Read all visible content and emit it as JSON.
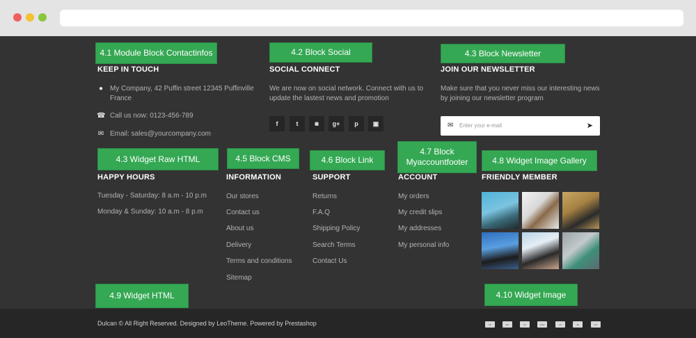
{
  "tags": {
    "contactinfos": "4.1 Module Block Contactinfos",
    "social": "4.2 Block Social",
    "newsletter": "4.3 Block Newsletter",
    "raw_html": "4.3 Widget Raw HTML",
    "cms": "4.5 Block CMS",
    "link": "4.6 Block Link",
    "myaccount_line1": "4.7 Block",
    "myaccount_line2": "Myaccountfooter",
    "gallery": "4.8 Widget Image Gallery",
    "html": "4.9 Widget HTML",
    "image": "4.10 Widget Image"
  },
  "contact": {
    "heading": "KEEP IN TOUCH",
    "address_line1": "My Company, 42 Puffin street 12345 Puffinville",
    "address_line2": "France",
    "phone": "Call us now: 0123-456-789",
    "email": "Email: sales@yourcompany.com",
    "icons": [
      "map-marker-icon",
      "phone-icon",
      "envelope-icon"
    ]
  },
  "social": {
    "heading": "SOCIAL CONNECT",
    "text_line1": "We are now on social network. Connect with us to",
    "text_line2": "update the lastest news and promotion",
    "icons": [
      "facebook-icon",
      "twitter-icon",
      "rss-icon",
      "google-plus-icon",
      "pinterest-icon",
      "instagram-icon"
    ]
  },
  "newsletter": {
    "heading": "JOIN OUR NEWSLETTER",
    "text_line1": "Make sure that you never miss our interesting news",
    "text_line2": "by joining our newsletter program",
    "placeholder": "Enter your e-mail"
  },
  "hours": {
    "heading": "HAPPY HOURS",
    "line1": "Tuesday - Saturday: 8 a.m - 10 p.m",
    "line2": "Monday & Sunday: 10 a.m - 8 p.m"
  },
  "information": {
    "heading": "INFORMATION",
    "items": [
      "Our stores",
      "Contact us",
      "About us",
      "Delivery",
      "Terms and conditions",
      "Sitemap"
    ]
  },
  "support": {
    "heading": "SUPPORT",
    "items": [
      "Returns",
      "F.A.Q",
      "Shipping Policy",
      "Search Terms",
      "Contact Us"
    ]
  },
  "account": {
    "heading": "ACCOUNT",
    "items": [
      "My orders",
      "My credit slips",
      "My addresses",
      "My personal info"
    ]
  },
  "gallery": {
    "heading": "FRIENDLY MEMBER"
  },
  "footer": {
    "copyright": "Dulcan © All Right Reserved. Designed by LeoTheme. Powered by Prestashop",
    "payments": [
      "paypal-icon",
      "mastercard-icon",
      "stripe-icon",
      "visa-icon",
      "amex-icon",
      "card-icon",
      "diners-icon"
    ]
  },
  "colors": {
    "tag_green": "#34a853",
    "footer_bg": "#333333",
    "bottom_bg": "#262626"
  }
}
